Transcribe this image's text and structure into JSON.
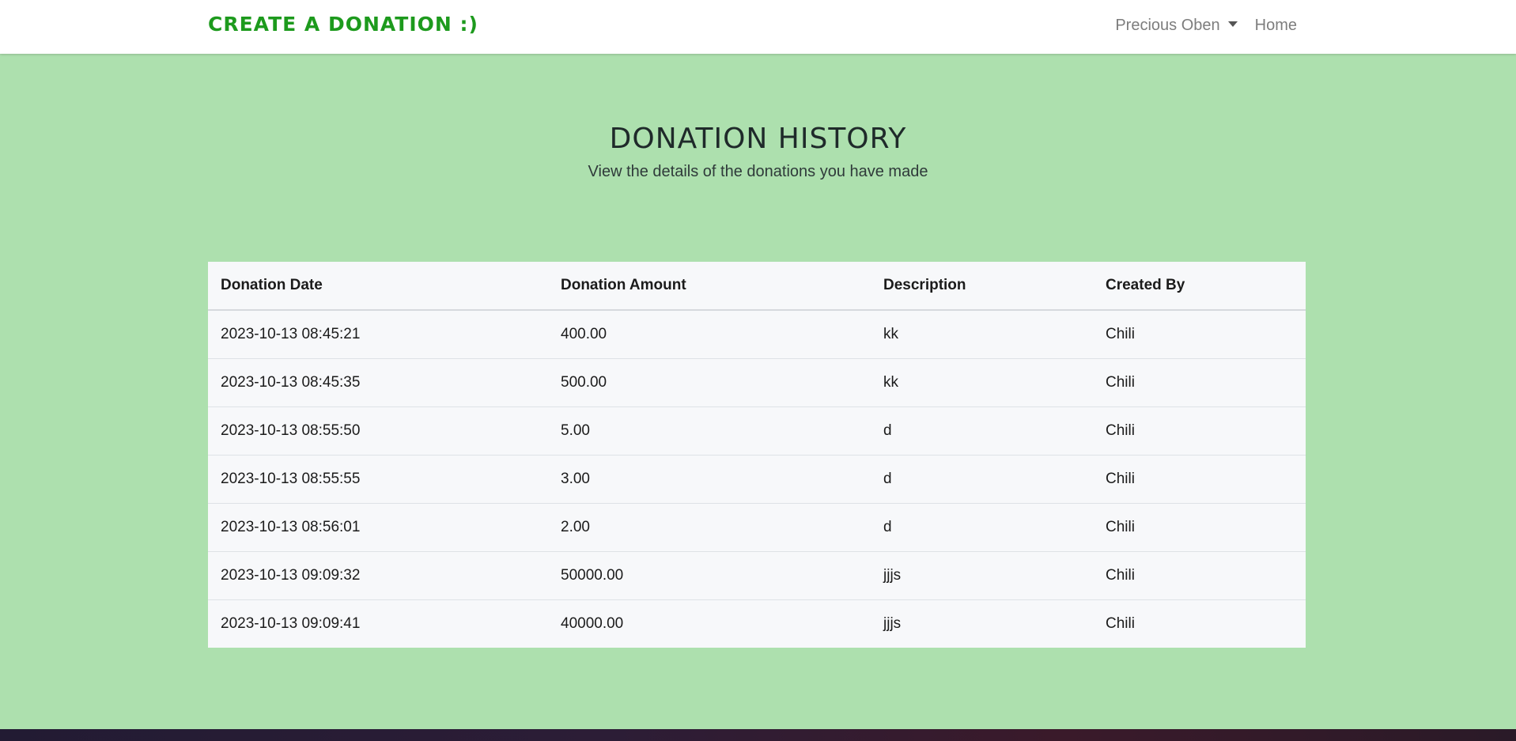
{
  "navbar": {
    "brand": "CREATE A DONATION :)",
    "user_menu_label": "Precious Oben",
    "home_link": "Home"
  },
  "hero": {
    "title": "DONATION HISTORY",
    "subtitle": "View the details of the donations you have made"
  },
  "table": {
    "headers": [
      "Donation Date",
      "Donation Amount",
      "Description",
      "Created By"
    ],
    "rows": [
      [
        "2023-10-13 08:45:21",
        "400.00",
        "kk",
        "Chili"
      ],
      [
        "2023-10-13 08:45:35",
        "500.00",
        "kk",
        "Chili"
      ],
      [
        "2023-10-13 08:55:50",
        "5.00",
        "d",
        "Chili"
      ],
      [
        "2023-10-13 08:55:55",
        "3.00",
        "d",
        "Chili"
      ],
      [
        "2023-10-13 08:56:01",
        "2.00",
        "d",
        "Chili"
      ],
      [
        "2023-10-13 09:09:32",
        "50000.00",
        "jjjs",
        "Chili"
      ],
      [
        "2023-10-13 09:09:41",
        "40000.00",
        "jjjs",
        "Chili"
      ]
    ]
  },
  "colors": {
    "background": "#ade0ae",
    "brand": "#1d9a1d",
    "table_bg": "#f7f8fa"
  },
  "icons": {
    "user_menu": "chevron-down-icon"
  }
}
